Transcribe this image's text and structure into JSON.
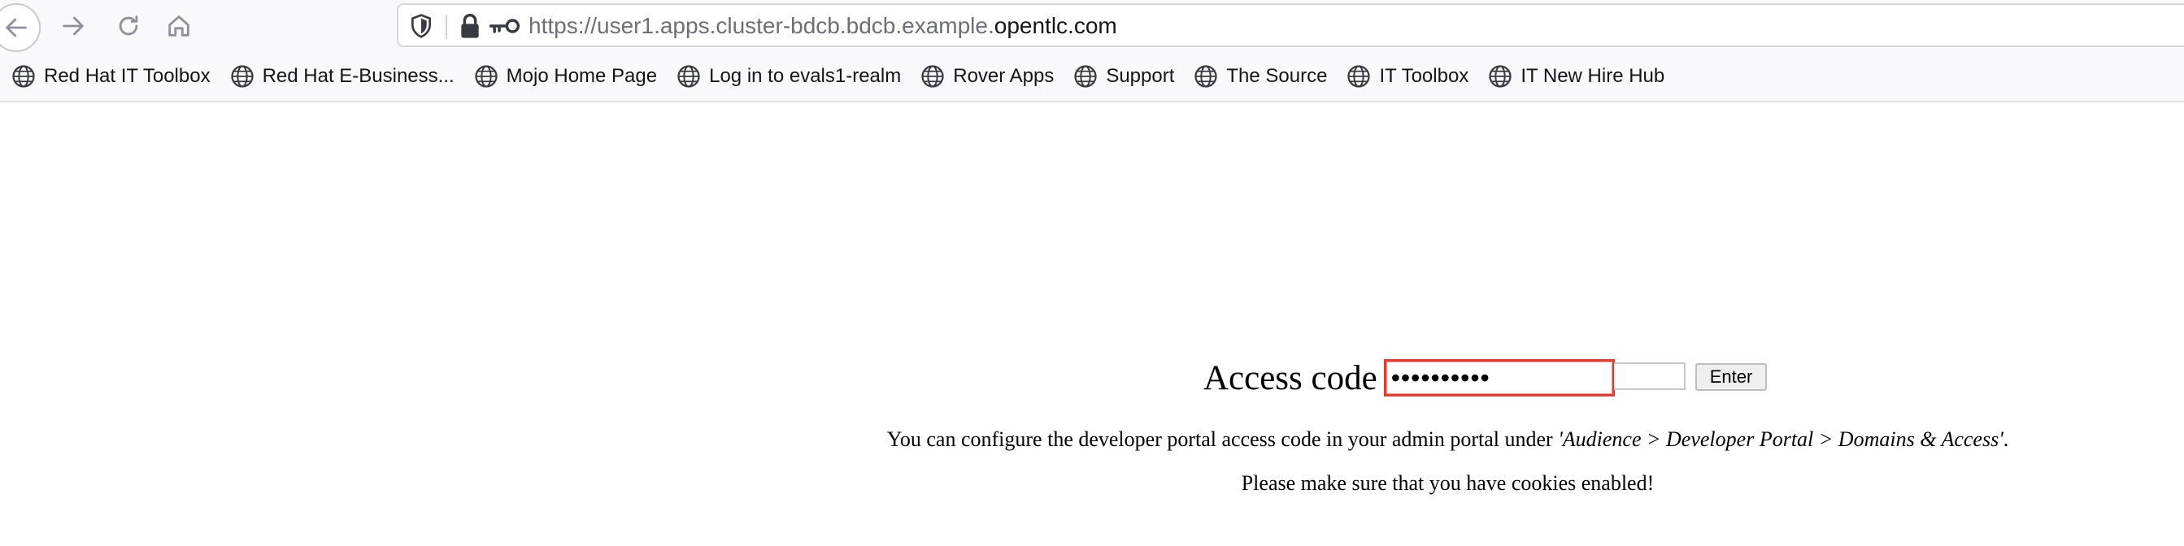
{
  "browser": {
    "url_prefix": "https://user1.apps.cluster-bdcb.bdcb.example.",
    "url_domain": "opentlc.com"
  },
  "bookmarks": [
    {
      "label": "Red Hat IT Toolbox",
      "icon": "globe-icon"
    },
    {
      "label": "Red Hat E-Business...",
      "icon": "globe-icon"
    },
    {
      "label": "Mojo Home Page",
      "icon": "globe-icon"
    },
    {
      "label": "Log in to evals1-realm",
      "icon": "globe-icon"
    },
    {
      "label": "Rover Apps",
      "icon": "globe-icon"
    },
    {
      "label": "Support",
      "icon": "globe-icon"
    },
    {
      "label": "The Source",
      "icon": "globe-icon"
    },
    {
      "label": "IT Toolbox",
      "icon": "globe-icon"
    },
    {
      "label": "IT New Hire Hub",
      "icon": "globe-icon"
    }
  ],
  "page": {
    "access_label": "Access code",
    "access_value": "••••••••••",
    "enter_label": "Enter",
    "help_text_start": "You can configure the developer portal access code in your admin portal under ",
    "help_text_path": "'Audience > Developer Portal > Domains & Access'",
    "help_text_end": ".",
    "cookies_text": "Please make sure that you have cookies enabled!"
  },
  "colors": {
    "highlight_border": "#e53b2f",
    "toolbar_bg": "#f9f9fb"
  }
}
